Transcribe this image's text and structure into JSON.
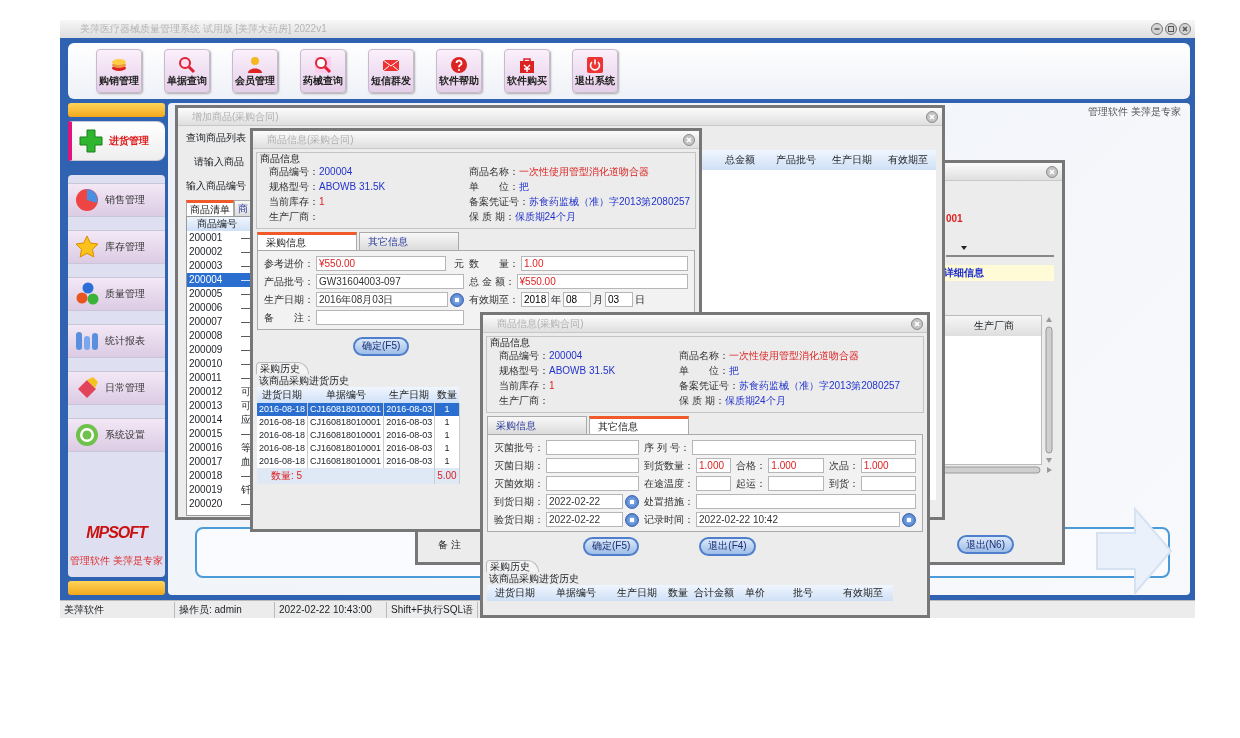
{
  "window": {
    "title": "美萍医疗器械质量管理系统 试用版 [美萍大药房] 2022v1"
  },
  "toolbar": [
    {
      "label": "购销管理"
    },
    {
      "label": "单据查询"
    },
    {
      "label": "会员管理"
    },
    {
      "label": "药械查询"
    },
    {
      "label": "短信群发"
    },
    {
      "label": "软件帮助"
    },
    {
      "label": "软件购买"
    },
    {
      "label": "退出系统"
    }
  ],
  "slogan": "管理软件 美萍是专家",
  "sidebar": {
    "items": [
      {
        "label": "进货管理",
        "selected": true
      },
      {
        "label": "销售管理",
        "selected": false
      },
      {
        "label": "库存管理",
        "selected": false
      },
      {
        "label": "质量管理",
        "selected": false
      },
      {
        "label": "统计报表",
        "selected": false
      },
      {
        "label": "日常管理",
        "selected": false
      },
      {
        "label": "系统设置",
        "selected": false
      }
    ],
    "logo": "MPSOFT",
    "logo_caption": "管理软件 美萍是专家"
  },
  "product_list_window": {
    "title": "增加商品(采购合同)",
    "group": "查询商品列表",
    "prompt": "请输入商品",
    "filter_label": "输入商品编号",
    "tabs": [
      {
        "label": "商品清单",
        "selected": true
      },
      {
        "label": "商",
        "selected": false
      }
    ],
    "column": "商品编号",
    "rows": [
      {
        "code": "200001",
        "name": "—",
        "selected": false
      },
      {
        "code": "200002",
        "name": "—",
        "selected": false
      },
      {
        "code": "200003",
        "name": "—",
        "selected": false
      },
      {
        "code": "200004",
        "name": "—",
        "selected": true
      },
      {
        "code": "200005",
        "name": "—",
        "selected": false
      },
      {
        "code": "200006",
        "name": "—",
        "selected": false
      },
      {
        "code": "200007",
        "name": "—",
        "selected": false
      },
      {
        "code": "200008",
        "name": "—",
        "selected": false
      },
      {
        "code": "200009",
        "name": "—",
        "selected": false
      },
      {
        "code": "200010",
        "name": "—",
        "selected": false
      },
      {
        "code": "200011",
        "name": "—",
        "selected": false
      },
      {
        "code": "200012",
        "name": "可",
        "selected": false
      },
      {
        "code": "200013",
        "name": "可",
        "selected": false
      },
      {
        "code": "200014",
        "name": "应",
        "selected": false
      },
      {
        "code": "200015",
        "name": "—",
        "selected": false
      },
      {
        "code": "200016",
        "name": "等",
        "selected": false
      },
      {
        "code": "200017",
        "name": "血",
        "selected": false
      },
      {
        "code": "200018",
        "name": "—",
        "selected": false
      },
      {
        "code": "200019",
        "name": "钎",
        "selected": false
      },
      {
        "code": "200020",
        "name": "—",
        "selected": false
      }
    ],
    "detail_columns": [
      "总金额",
      "产品批号",
      "生产日期",
      "有效期至"
    ]
  },
  "record_window": {
    "code": "001",
    "detail_label": "详细信息",
    "column": "生产厂商",
    "remark_label": "备 注",
    "exit_button": "退出(N6)"
  },
  "purchase_window": {
    "title": "商品信息(采购合同)",
    "group": "商品信息",
    "left": [
      {
        "label": "商品编号：",
        "value": "200004",
        "alert": false
      },
      {
        "label": "规格型号：",
        "value": "ABOWB 31.5K",
        "alert": false
      },
      {
        "label": "当前库存：",
        "value": "1",
        "alert": true
      },
      {
        "label": "生产厂商："
      }
    ],
    "right": [
      {
        "label": "商品名称：",
        "value": "一次性使用管型消化道吻合器",
        "alert": true
      },
      {
        "label": "单　　位：",
        "value": "把",
        "alert": false
      },
      {
        "label": "备案凭证号：",
        "value": "苏食药监械（准）字2013第2080257",
        "alert": false
      },
      {
        "label": "保 质 期：",
        "value": "保质期24个月",
        "alert": false
      }
    ],
    "tabs": [
      {
        "label": "采购信息",
        "selected": true
      },
      {
        "label": "其它信息",
        "selected": false
      }
    ],
    "fields": [
      [
        {
          "label": "参考进价：",
          "value": "¥550.00",
          "alert": true,
          "unit": "元"
        },
        {
          "label": "数　　量：",
          "value": "1.00",
          "alert": true
        }
      ],
      [
        {
          "label": "产品批号：",
          "value": "GW31604003-097"
        },
        {
          "label": "总 金 额：",
          "value": "¥550.00",
          "alert": true
        }
      ],
      [
        {
          "label": "生产日期：",
          "kind": "date",
          "value": "2016年08月03日"
        },
        {
          "label": "有效期至：",
          "kind": "ymd",
          "parts": [
            {
              "value": "2018",
              "unit": "年"
            },
            {
              "value": "08",
              "unit": "月"
            },
            {
              "value": "03",
              "unit": "日"
            }
          ]
        }
      ],
      [
        {
          "label": "备　　注："
        }
      ]
    ],
    "buttons": [
      "确定(F5)"
    ],
    "history_tab": "采购历史",
    "history_title": "该商品采购进货历史",
    "history_columns": [
      "进货日期",
      "单据编号",
      "生产日期",
      "数量"
    ],
    "history_rows": [
      {
        "cells": [
          "2016-08-18",
          "CJ160818010001",
          "2016-08-03",
          "1"
        ],
        "selected": true
      },
      {
        "cells": [
          "2016-08-18",
          "CJ160818010001",
          "2016-08-03",
          "1"
        ],
        "selected": false
      },
      {
        "cells": [
          "2016-08-18",
          "CJ160818010001",
          "2016-08-03",
          "1"
        ],
        "selected": false
      },
      {
        "cells": [
          "2016-08-18",
          "CJ160818010001",
          "2016-08-03",
          "1"
        ],
        "selected": false
      },
      {
        "cells": [
          "2016-08-18",
          "CJ160818010001",
          "2016-08-03",
          "1"
        ],
        "selected": false
      }
    ],
    "history_footer": [
      "数量: 5",
      "5.00"
    ]
  },
  "other_window": {
    "title": "商品信息(采购合同)",
    "group": "商品信息",
    "left": [
      {
        "label": "商品编号：",
        "value": "200004",
        "alert": false
      },
      {
        "label": "规格型号：",
        "value": "ABOWB 31.5K",
        "alert": false
      },
      {
        "label": "当前库存：",
        "value": "1",
        "alert": true
      },
      {
        "label": "生产厂商："
      }
    ],
    "right": [
      {
        "label": "商品名称：",
        "value": "一次性使用管型消化道吻合器",
        "alert": true
      },
      {
        "label": "单　　位：",
        "value": "把",
        "alert": false
      },
      {
        "label": "备案凭证号：",
        "value": "苏食药监械（准）字2013第2080257",
        "alert": false
      },
      {
        "label": "保 质 期：",
        "value": "保质期24个月",
        "alert": false
      }
    ],
    "tabs": [
      {
        "label": "采购信息",
        "selected": false
      },
      {
        "label": "其它信息",
        "selected": true
      }
    ],
    "fields": [
      [
        {
          "label": "灭菌批号："
        },
        {
          "label": "序 列 号："
        }
      ],
      [
        {
          "label": "灭菌日期："
        },
        {
          "label": "到货数量：",
          "value": "1.000",
          "alert": true
        },
        {
          "label": "合格：",
          "value": "1.000",
          "alert": true
        },
        {
          "label": "次品：",
          "value": "1.000",
          "alert": true
        }
      ],
      [
        {
          "label": "灭菌效期："
        },
        {
          "label": "在途温度："
        },
        {
          "label": "起运："
        },
        {
          "label": "到货："
        }
      ],
      [
        {
          "label": "到货日期：",
          "kind": "date",
          "value": "2022-02-22"
        },
        {
          "label": "处置措施："
        }
      ],
      [
        {
          "label": "验货日期：",
          "kind": "date",
          "value": "2022-02-22"
        },
        {
          "label": "记录时间：",
          "kind": "date",
          "value": "2022-02-22 10:42"
        }
      ]
    ],
    "buttons": [
      "确定(F5)",
      "退出(F4)"
    ],
    "history_tab": "采购历史",
    "history_title": "该商品采购进货历史",
    "history_columns": [
      "进货日期",
      "单据编号",
      "生产日期",
      "数量",
      "合计金额",
      "单价",
      "批号",
      "有效期至"
    ]
  },
  "status_bar": [
    "美萍软件",
    "操作员: admin",
    "2022-02-22 10:43:00",
    "Shift+F执行SQL语"
  ]
}
